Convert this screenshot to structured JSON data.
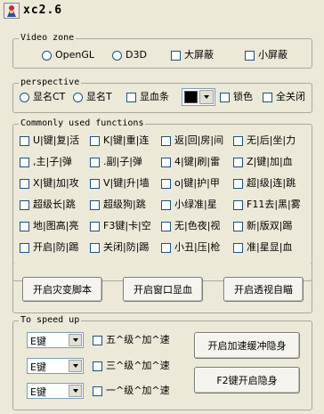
{
  "window": {
    "title": "xc2.6",
    "icon": "game-character-icon"
  },
  "video_zone": {
    "legend": "Video zone",
    "options": [
      {
        "label": "OpenGL",
        "type": "radio",
        "checked": false
      },
      {
        "label": "D3D",
        "type": "radio",
        "checked": false
      },
      {
        "label": "大屏蔽",
        "type": "checkbox",
        "checked": false
      },
      {
        "label": "小屏蔽",
        "type": "checkbox",
        "checked": false
      }
    ]
  },
  "perspective": {
    "legend": "perspective",
    "radio1": "显名CT",
    "radio2": "显名T",
    "check_blood": "显血条",
    "color_value": "#000000",
    "check_lock": "锁色",
    "check_all_off": "全关闭"
  },
  "functions": {
    "legend": "Commonly used functions",
    "rows": [
      [
        "U|键|复|活",
        "K|键|重|连",
        "返|回|房|间",
        "无|后|坐|力"
      ],
      [
        ",主|子|弹",
        ".副|子|弹",
        "4|键|刷|雷",
        "Z|键|加|血"
      ],
      [
        "X|键|加|攻",
        "V|键|升|墙",
        "o|键|护|甲",
        "超|级|连|跳"
      ],
      [
        "超级长|跳",
        "超级狗|跳",
        "小绿准|星",
        "F11去|黑|雾"
      ],
      [
        "地|图高|亮",
        "F3键|卡|空",
        "无|色夜|视",
        "新|版双|踢"
      ],
      [
        "开启|防|踢",
        "关闭|防|踢",
        "小丑|压|枪",
        "准|星显|血"
      ]
    ]
  },
  "buttons": {
    "b1": "开启灾变脚本",
    "b2": "开启窗口显血",
    "b3": "开启透视自瞄"
  },
  "speed": {
    "legend": "To speed up",
    "rows": [
      {
        "key": "E键",
        "label": "五^级^加^速"
      },
      {
        "key": "E键",
        "label": "三^级^加^速"
      },
      {
        "key": "E键",
        "label": "一^级^加^速"
      }
    ],
    "btn_buffer": "开启加速缓冲隐身",
    "btn_f2": "F2键开启隐身"
  }
}
